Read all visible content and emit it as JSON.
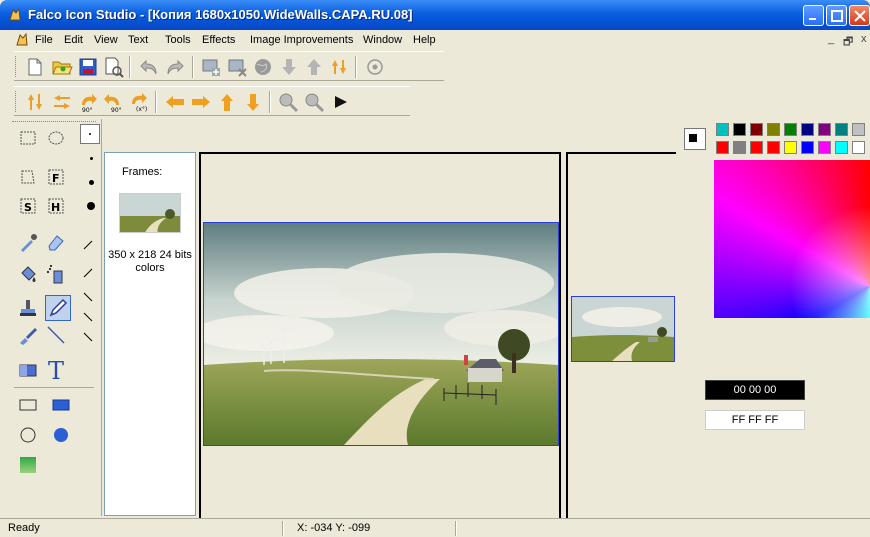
{
  "window": {
    "title": "Falco Icon Studio - [Копия 1680x1050.WideWalls.CAPA.RU.08]",
    "icon": "app-icon"
  },
  "menu": {
    "items": [
      "File",
      "Edit",
      "View",
      "Text",
      "Tools",
      "Effects",
      "Image Improvements",
      "Window",
      "Help"
    ],
    "mdi_controls": [
      "_",
      "🗗",
      "x"
    ]
  },
  "toolbar1": {
    "buttons": [
      "new-icon",
      "open-icon",
      "save-icon",
      "print-preview-icon",
      "undo-icon",
      "redo-icon",
      "add-frame-icon",
      "delete-frame-icon",
      "globe-icon",
      "move-down-icon",
      "move-up-icon",
      "swap-icon",
      "target-icon"
    ]
  },
  "toolbar2": {
    "buttons": [
      "flip-vertical-icon",
      "flip-horizontal-icon",
      "rotate-90-right-icon",
      "rotate-90-left-icon",
      "rotate-free-icon",
      "shift-left-icon",
      "shift-right-icon",
      "shift-up-icon",
      "shift-down-icon",
      "zoom-in-icon",
      "zoom-out-icon",
      "play-icon"
    ]
  },
  "frames": {
    "header": "Frames:",
    "items": [
      {
        "label": "350 x 218 24 bits colors"
      }
    ]
  },
  "colors": {
    "foreground_hex": "00 00 00",
    "background_hex": "FF FF FF",
    "palette_row1": [
      "#00c0c0",
      "#000000",
      "#800000",
      "#808000",
      "#008000",
      "#000080",
      "#800080",
      "#008080",
      "#c0c0c0"
    ],
    "palette_row2": [
      "#ff0000",
      "#808080",
      "#ff0000",
      "#ff0000",
      "#ffff00",
      "#0000ff",
      "#ff00ff",
      "#00ffff",
      "#ffffff"
    ]
  },
  "status": {
    "text": "Ready",
    "coords": "X: -034 Y: -099"
  }
}
